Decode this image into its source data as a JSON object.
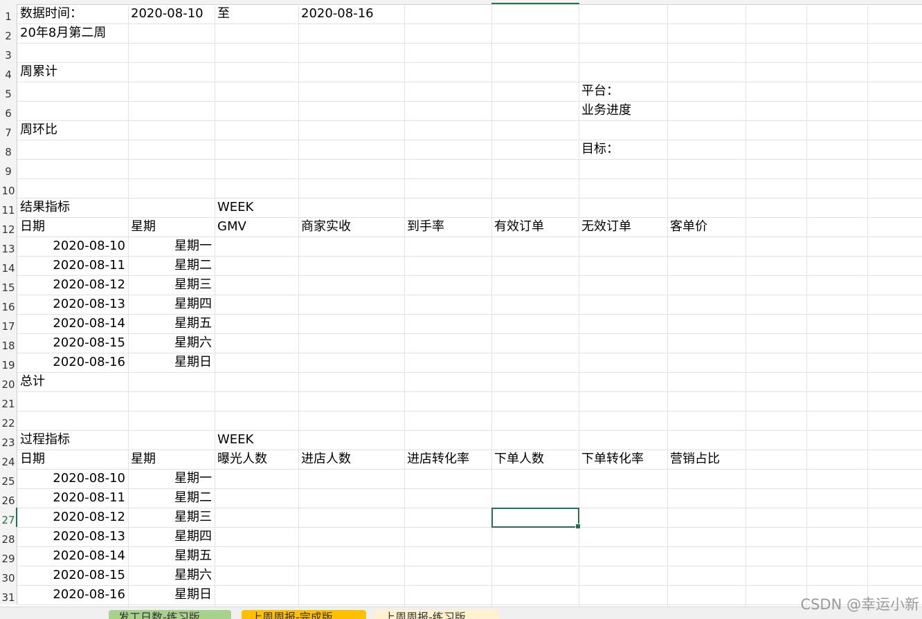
{
  "sheet": {
    "rows": [
      [
        {
          "col": "A",
          "text": "数据时间："
        },
        {
          "col": "B",
          "text": "2020-08-10"
        },
        {
          "col": "C",
          "text": "至"
        },
        {
          "col": "D",
          "text": "2020-08-16"
        }
      ],
      [
        {
          "col": "A",
          "text": "20年8月第二周"
        }
      ],
      [],
      [
        {
          "col": "A",
          "text": "周累计"
        }
      ],
      [
        {
          "col": "G",
          "text": "平台："
        }
      ],
      [
        {
          "col": "G",
          "text": "业务进度"
        }
      ],
      [
        {
          "col": "A",
          "text": "周环比"
        }
      ],
      [
        {
          "col": "G",
          "text": "目标："
        }
      ],
      [],
      [],
      [
        {
          "col": "A",
          "text": "结果指标"
        },
        {
          "col": "C",
          "text": "WEEK"
        }
      ],
      [
        {
          "col": "A",
          "text": "日期"
        },
        {
          "col": "B",
          "text": "星期"
        },
        {
          "col": "C",
          "text": "GMV"
        },
        {
          "col": "D",
          "text": "商家实收"
        },
        {
          "col": "E",
          "text": "到手率"
        },
        {
          "col": "F",
          "text": "有效订单"
        },
        {
          "col": "G",
          "text": "无效订单"
        },
        {
          "col": "H",
          "text": "客单价"
        }
      ],
      [
        {
          "col": "A",
          "text": "2020-08-10",
          "align": "right"
        },
        {
          "col": "B",
          "text": "星期一",
          "align": "right"
        }
      ],
      [
        {
          "col": "A",
          "text": "2020-08-11",
          "align": "right"
        },
        {
          "col": "B",
          "text": "星期二",
          "align": "right"
        }
      ],
      [
        {
          "col": "A",
          "text": "2020-08-12",
          "align": "right"
        },
        {
          "col": "B",
          "text": "星期三",
          "align": "right"
        }
      ],
      [
        {
          "col": "A",
          "text": "2020-08-13",
          "align": "right"
        },
        {
          "col": "B",
          "text": "星期四",
          "align": "right"
        }
      ],
      [
        {
          "col": "A",
          "text": "2020-08-14",
          "align": "right"
        },
        {
          "col": "B",
          "text": "星期五",
          "align": "right"
        }
      ],
      [
        {
          "col": "A",
          "text": "2020-08-15",
          "align": "right"
        },
        {
          "col": "B",
          "text": "星期六",
          "align": "right"
        }
      ],
      [
        {
          "col": "A",
          "text": "2020-08-16",
          "align": "right"
        },
        {
          "col": "B",
          "text": "星期日",
          "align": "right"
        }
      ],
      [
        {
          "col": "A",
          "text": "总计"
        }
      ],
      [],
      [],
      [
        {
          "col": "A",
          "text": "过程指标"
        },
        {
          "col": "C",
          "text": "WEEK"
        }
      ],
      [
        {
          "col": "A",
          "text": "日期"
        },
        {
          "col": "B",
          "text": "星期"
        },
        {
          "col": "C",
          "text": "曝光人数"
        },
        {
          "col": "D",
          "text": "进店人数"
        },
        {
          "col": "E",
          "text": "进店转化率"
        },
        {
          "col": "F",
          "text": "下单人数"
        },
        {
          "col": "G",
          "text": "下单转化率"
        },
        {
          "col": "H",
          "text": "营销占比"
        }
      ],
      [
        {
          "col": "A",
          "text": "2020-08-10",
          "align": "right"
        },
        {
          "col": "B",
          "text": "星期一",
          "align": "right"
        }
      ],
      [
        {
          "col": "A",
          "text": "2020-08-11",
          "align": "right"
        },
        {
          "col": "B",
          "text": "星期二",
          "align": "right"
        }
      ],
      [
        {
          "col": "A",
          "text": "2020-08-12",
          "align": "right"
        },
        {
          "col": "B",
          "text": "星期三",
          "align": "right"
        }
      ],
      [
        {
          "col": "A",
          "text": "2020-08-13",
          "align": "right"
        },
        {
          "col": "B",
          "text": "星期四",
          "align": "right"
        }
      ],
      [
        {
          "col": "A",
          "text": "2020-08-14",
          "align": "right"
        },
        {
          "col": "B",
          "text": "星期五",
          "align": "right"
        }
      ],
      [
        {
          "col": "A",
          "text": "2020-08-15",
          "align": "right"
        },
        {
          "col": "B",
          "text": "星期六",
          "align": "right"
        }
      ],
      [
        {
          "col": "A",
          "text": "2020-08-16",
          "align": "right"
        },
        {
          "col": "B",
          "text": "星期日",
          "align": "right"
        }
      ]
    ],
    "row_numbers": [
      "1",
      "2",
      "3",
      "4",
      "5",
      "6",
      "7",
      "8",
      "9",
      "10",
      "11",
      "12",
      "13",
      "14",
      "15",
      "16",
      "17",
      "18",
      "19",
      "20",
      "21",
      "22",
      "23",
      "24",
      "25",
      "26",
      "27",
      "28",
      "29",
      "30",
      "31"
    ],
    "active_cell": {
      "row": 27,
      "col": "F"
    }
  },
  "tabs": [
    {
      "label": "发工日数-练习版",
      "color": "#a9d18e"
    },
    {
      "label": "上周周报-完成版",
      "color": "#ffc000"
    },
    {
      "label": "上周周报-练习版",
      "color": "#fff2cc"
    }
  ],
  "watermark": "CSDN @幸运小新",
  "colors": {
    "accent": "#217346",
    "grid": "#e2e2e2",
    "header_bg": "#f3f3f3"
  }
}
